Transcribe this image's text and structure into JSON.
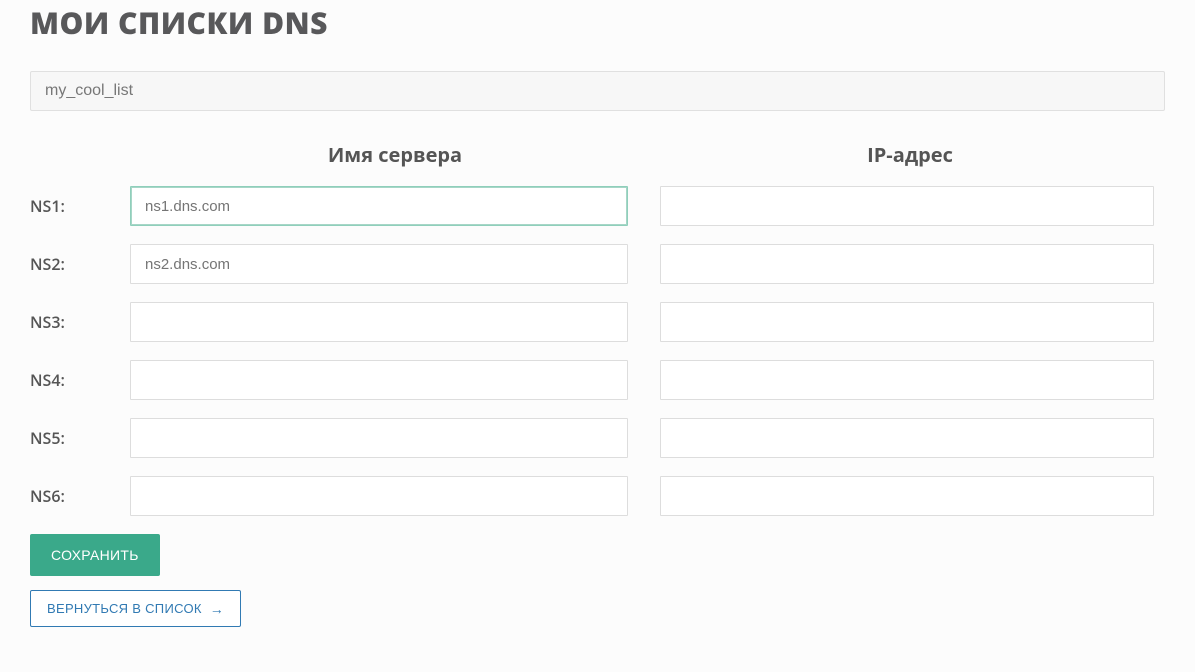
{
  "title": "МОИ СПИСКИ DNS",
  "list_name_value": "my_cool_list",
  "headers": {
    "server": "Имя сервера",
    "ip": "IP-адрес"
  },
  "rows": [
    {
      "label": "NS1:",
      "server_placeholder": "ns1.dns.com",
      "server_value": "",
      "ip_value": ""
    },
    {
      "label": "NS2:",
      "server_placeholder": "ns2.dns.com",
      "server_value": "",
      "ip_value": ""
    },
    {
      "label": "NS3:",
      "server_placeholder": "",
      "server_value": "",
      "ip_value": ""
    },
    {
      "label": "NS4:",
      "server_placeholder": "",
      "server_value": "",
      "ip_value": ""
    },
    {
      "label": "NS5:",
      "server_placeholder": "",
      "server_value": "",
      "ip_value": ""
    },
    {
      "label": "NS6:",
      "server_placeholder": "",
      "server_value": "",
      "ip_value": ""
    }
  ],
  "buttons": {
    "save": "СОХРАНИТЬ",
    "back": "ВЕРНУТЬСЯ В СПИСОК"
  },
  "colors": {
    "primary": "#3aa98a",
    "link": "#317ab3"
  }
}
